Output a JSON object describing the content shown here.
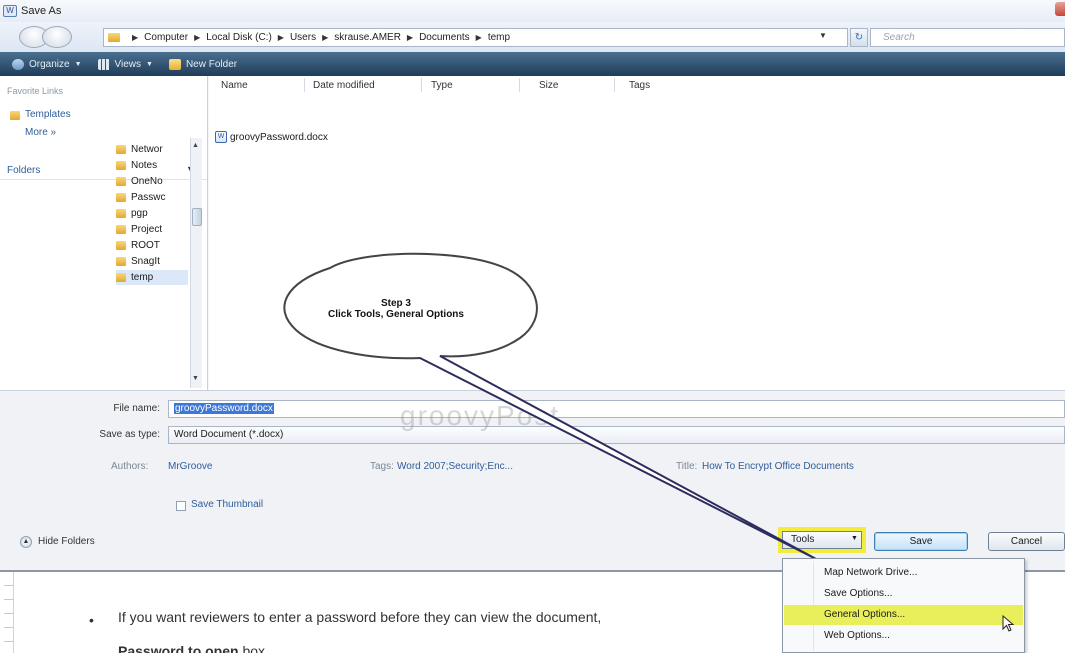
{
  "window": {
    "title": "Save As"
  },
  "address": {
    "crumbs": [
      "Computer",
      "Local Disk (C:)",
      "Users",
      "skrause.AMER",
      "Documents",
      "temp"
    ],
    "search_placeholder": "Search"
  },
  "toolbar": {
    "organize": "Organize",
    "views": "Views",
    "new_folder": "New Folder"
  },
  "nav": {
    "favorite_links_heading": "Favorite Links",
    "templates": "Templates",
    "more": "More »",
    "folders_label": "Folders",
    "folders": [
      "Networ",
      "Notes",
      "OneNo",
      "Passwc",
      "pgp",
      "Project",
      "ROOT",
      "SnagIt",
      "temp"
    ]
  },
  "filelist": {
    "columns": [
      "Name",
      "Date modified",
      "Type",
      "Size",
      "Tags"
    ],
    "files": [
      {
        "name": "groovyPassword.docx"
      }
    ]
  },
  "form": {
    "file_name_label": "File name:",
    "file_name_value": "groovyPassword.docx",
    "save_type_label": "Save as type:",
    "save_type_value": "Word Document (*.docx)",
    "authors_label": "Authors:",
    "authors_value": "MrGroove",
    "tags_label": "Tags:",
    "tags_value": "Word 2007;Security;Enc...",
    "title_label": "Title:",
    "title_value": "How To Encrypt Office Documents",
    "save_thumbnail": "Save Thumbnail",
    "hide_folders": "Hide Folders",
    "tools": "Tools",
    "save": "Save",
    "cancel": "Cancel"
  },
  "tools_menu": {
    "items": [
      "Map Network Drive...",
      "Save Options...",
      "General Options...",
      "Web Options..."
    ],
    "highlighted_item": "General Options..."
  },
  "callout": {
    "line1": "Step 3",
    "line2": "Click Tools, General Options"
  },
  "watermark": "groovyPost",
  "document": {
    "bullet_text": "If you want reviewers to enter a password before they can view the document,",
    "line2_bold": "Password to open",
    "line2_rest": " box."
  },
  "colors": {
    "highlight_yellow": "#f2ec3c",
    "toolbar_dark": "#1f3d59",
    "link_blue": "#2f5d9a",
    "selection_blue": "#3d78d8"
  }
}
